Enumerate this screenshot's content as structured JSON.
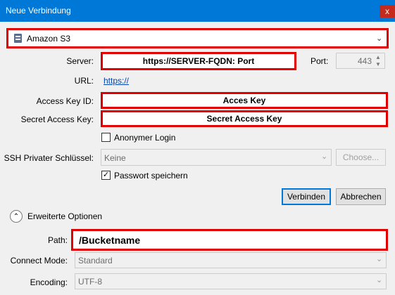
{
  "window": {
    "title": "Neue Verbindung",
    "close": "x"
  },
  "protocol": {
    "selected": "Amazon S3"
  },
  "server": {
    "label": "Server:",
    "value": "https://SERVER-FQDN: Port"
  },
  "port": {
    "label": "Port:",
    "value": "443"
  },
  "url": {
    "label": "URL:",
    "value": "https://"
  },
  "access_key": {
    "label": "Access Key ID:",
    "value": "Acces Key"
  },
  "secret_key": {
    "label": "Secret Access Key:",
    "value": "Secret Access Key"
  },
  "anonymous": {
    "label": "Anonymer Login",
    "checked": false
  },
  "ssh": {
    "label": "SSH Privater Schlüssel:",
    "value": "Keine",
    "choose": "Choose..."
  },
  "save_password": {
    "label": "Passwort speichern",
    "checked": true,
    "mark": "✓"
  },
  "buttons": {
    "connect": "Verbinden",
    "cancel": "Abbrechen"
  },
  "advanced": {
    "label": "Erweiterte Optionen"
  },
  "path": {
    "label": "Path:",
    "value": "/Bucketname"
  },
  "connect_mode": {
    "label": "Connect Mode:",
    "value": "Standard"
  },
  "encoding": {
    "label": "Encoding:",
    "value": "UTF-8"
  },
  "colors": {
    "titlebar": "#0078d7",
    "highlight": "#e00000",
    "link": "#0645ad"
  }
}
